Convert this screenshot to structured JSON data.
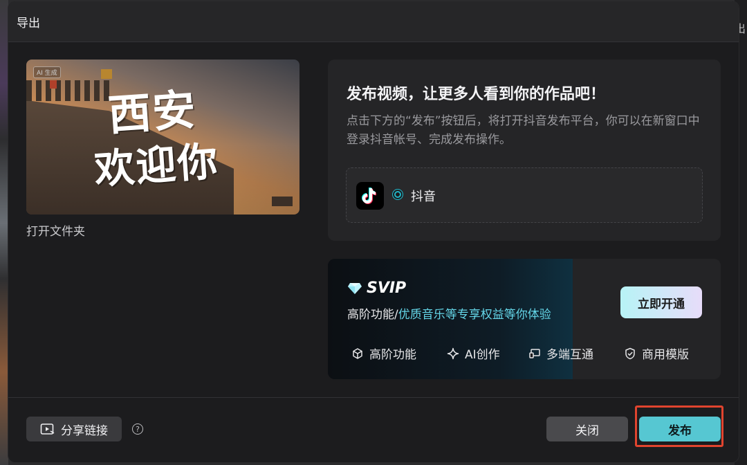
{
  "dialog": {
    "title": "导出"
  },
  "background": {
    "right_edge_text": "出"
  },
  "thumbnail": {
    "ai_badge": "AI 生成",
    "calligraphy_line1": "西安",
    "calligraphy_line2": "欢迎你",
    "open_folder_label": "打开文件夹"
  },
  "publish": {
    "heading": "发布视频，让更多人看到你的作品吧！",
    "description": "点击下方的“发布”按钮后，将打开抖音发布平台，你可以在新窗口中登录抖音帐号、完成发布操作。",
    "platform_label": "抖音"
  },
  "svip": {
    "title": "SVIP",
    "subtitle_prefix": "高阶功能/",
    "subtitle_highlight": "优质音乐等专享权益等你体验",
    "open_button": "立即开通",
    "features": [
      "高阶功能",
      "AI创作",
      "多端互通",
      "商用模版"
    ]
  },
  "footer": {
    "share_button": "分享链接",
    "close_button": "关闭",
    "publish_button": "发布"
  },
  "colors": {
    "accent": "#56c7d2",
    "highlight_border": "#e0442e",
    "svip_highlight_text": "#64d6e8"
  }
}
